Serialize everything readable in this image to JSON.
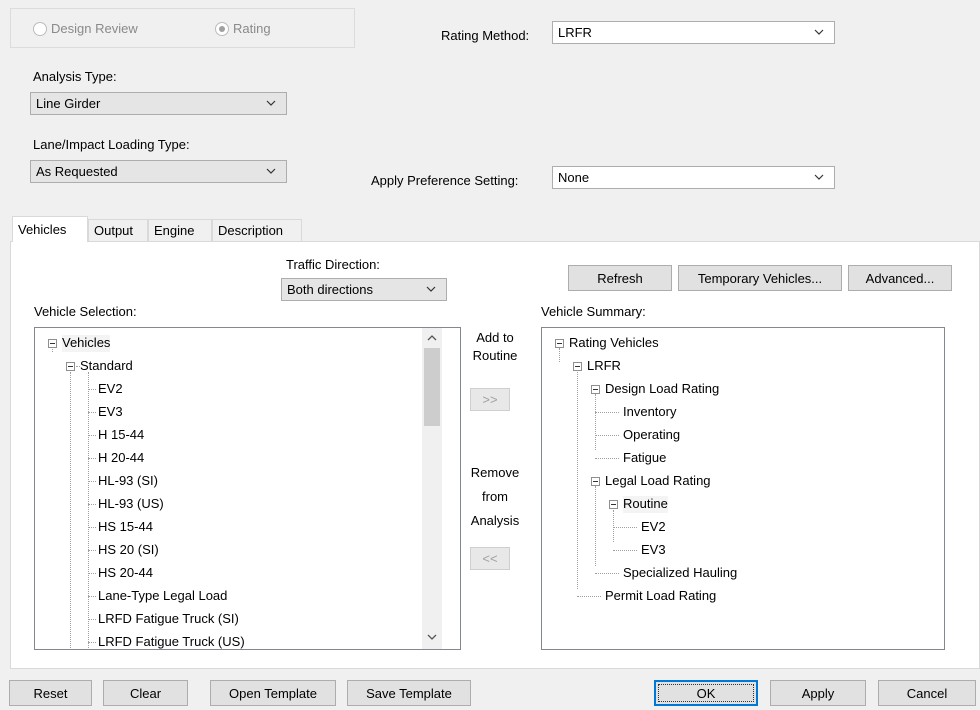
{
  "rating_mode": {
    "design_review_label": "Design Review",
    "rating_label": "Rating",
    "selected": "Rating"
  },
  "rating_method": {
    "label": "Rating Method:",
    "value": "LRFR"
  },
  "analysis_type": {
    "label": "Analysis Type:",
    "value": "Line Girder"
  },
  "lane_impact": {
    "label": "Lane/Impact Loading Type:",
    "value": "As Requested"
  },
  "apply_preference": {
    "label": "Apply Preference Setting:",
    "value": "None"
  },
  "tabs": [
    {
      "label": "Vehicles",
      "active": true
    },
    {
      "label": "Output"
    },
    {
      "label": "Engine"
    },
    {
      "label": "Description"
    }
  ],
  "traffic_direction": {
    "label": "Traffic Direction:",
    "value": "Both directions"
  },
  "vehicle_selection": {
    "label": "Vehicle Selection:",
    "root": "Vehicles",
    "group": "Standard",
    "items": [
      "EV2",
      "EV3",
      "H 15-44",
      "H 20-44",
      "HL-93 (SI)",
      "HL-93 (US)",
      "HS 15-44",
      "HS 20 (SI)",
      "HS 20-44",
      "Lane-Type Legal Load",
      "LRFD Fatigue Truck (SI)",
      "LRFD Fatigue Truck (US)"
    ]
  },
  "middle": {
    "add_line1": "Add to",
    "add_line2": "Routine",
    "add_button": ">>",
    "remove_line1": "Remove",
    "remove_line2": "from",
    "remove_line3": "Analysis",
    "remove_button": "<<"
  },
  "top_buttons": {
    "refresh": "Refresh",
    "temporary": "Temporary Vehicles...",
    "advanced": "Advanced..."
  },
  "vehicle_summary": {
    "label": "Vehicle Summary:",
    "root": "Rating Vehicles",
    "method": "LRFR",
    "design": "Design Load Rating",
    "inventory": "Inventory",
    "operating": "Operating",
    "fatigue": "Fatigue",
    "legal": "Legal Load Rating",
    "routine": "Routine",
    "ev2": "EV2",
    "ev3": "EV3",
    "specialized": "Specialized Hauling",
    "permit": "Permit Load Rating"
  },
  "bottom_buttons": {
    "reset": "Reset",
    "clear": "Clear",
    "open_template": "Open Template",
    "save_template": "Save Template",
    "ok": "OK",
    "apply": "Apply",
    "cancel": "Cancel"
  },
  "colors": {
    "focus_blue": "#0078d7",
    "panel_bg": "#f0f0f0",
    "tree_border": "#828790"
  }
}
